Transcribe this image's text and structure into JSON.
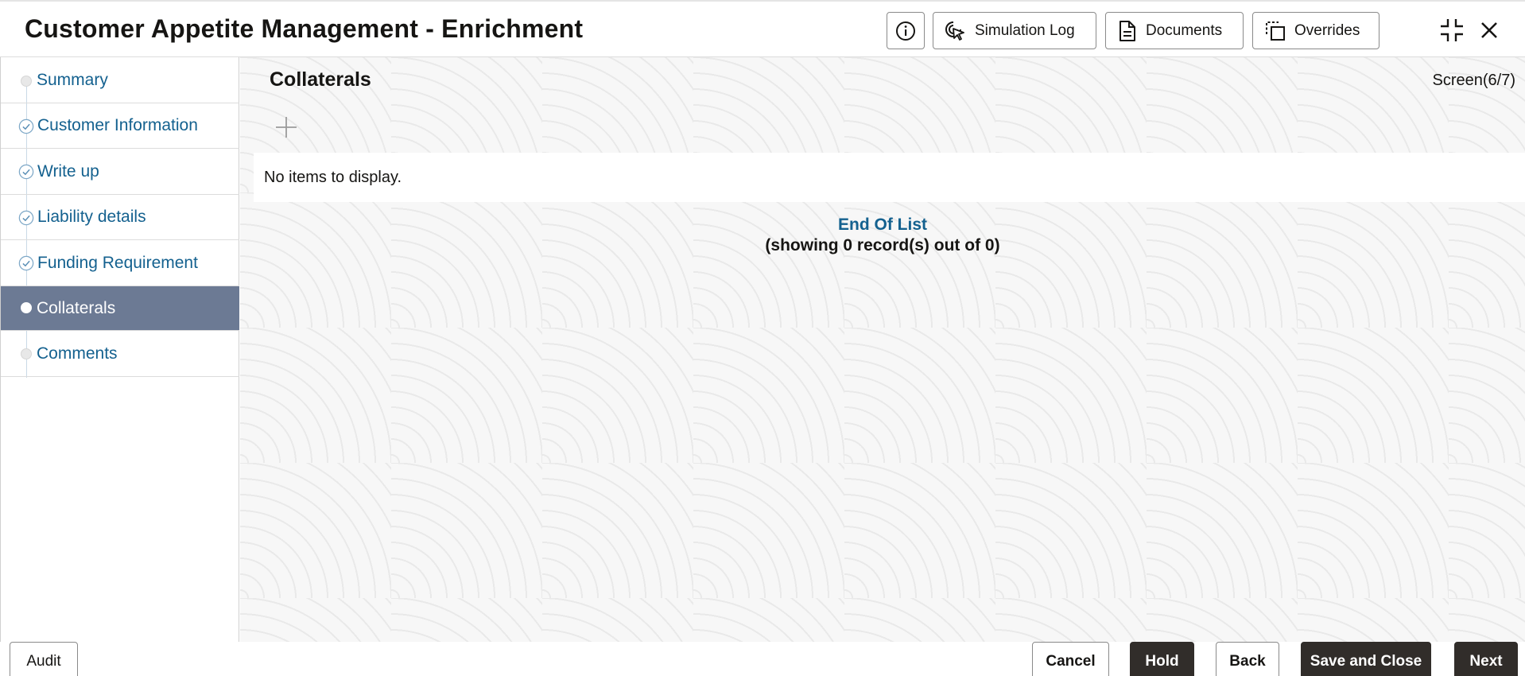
{
  "header": {
    "title": "Customer Appetite Management - Enrichment",
    "buttons": {
      "simulation_log": "Simulation Log",
      "documents": "Documents",
      "overrides": "Overrides"
    }
  },
  "sidebar": {
    "items": [
      {
        "label": "Summary",
        "state": "pending"
      },
      {
        "label": "Customer Information",
        "state": "completed"
      },
      {
        "label": "Write up",
        "state": "completed"
      },
      {
        "label": "Liability details",
        "state": "completed"
      },
      {
        "label": "Funding Requirement",
        "state": "completed"
      },
      {
        "label": "Collaterals",
        "state": "active"
      },
      {
        "label": "Comments",
        "state": "pending"
      }
    ]
  },
  "main": {
    "title": "Collaterals",
    "screen_indicator": "Screen(6/7)",
    "empty_message": "No items to display.",
    "end_of_list": "End Of List",
    "record_count": "(showing 0 record(s) out of 0)"
  },
  "footer": {
    "audit": "Audit",
    "cancel": "Cancel",
    "hold": "Hold",
    "back": "Back",
    "save_and_close": "Save and Close",
    "next": "Next"
  },
  "colors": {
    "accent_link": "#14618f",
    "active_nav_bg": "#6c7a94",
    "primary_button": "#312d2a"
  },
  "icons": {
    "info": "info-icon",
    "simulation_log": "cursor-click-icon",
    "documents": "document-icon",
    "overrides": "overrides-icon",
    "collapse": "collapse-icon",
    "close": "close-icon",
    "add": "plus-icon",
    "completed_step": "check-circle-icon",
    "pending_step": "dot-icon"
  }
}
